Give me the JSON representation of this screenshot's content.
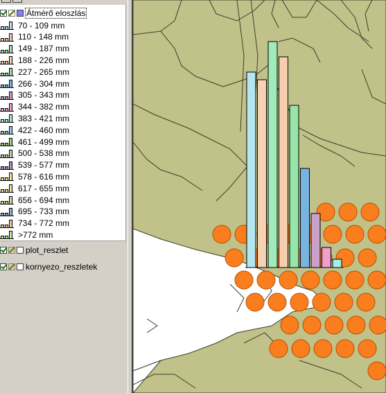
{
  "legend": {
    "layer_title": "Átmérő eloszlás",
    "classes": [
      {
        "label": "70 - 109 mm",
        "color": "#b4e6f0"
      },
      {
        "label": "110 - 148 mm",
        "color": "#f5d2b4"
      },
      {
        "label": "149 - 187 mm",
        "color": "#a0ebb9"
      },
      {
        "label": "188 - 226 mm",
        "color": "#f5cdaf"
      },
      {
        "label": "227 - 265 mm",
        "color": "#96e6aa"
      },
      {
        "label": "266 - 304 mm",
        "color": "#78b4e1"
      },
      {
        "label": "305 - 343 mm",
        "color": "#c8a0c8"
      },
      {
        "label": "344 - 382 mm",
        "color": "#f0a0c8"
      },
      {
        "label": "383 - 421 mm",
        "color": "#a0f0e6"
      },
      {
        "label": "422 - 460 mm",
        "color": "#a0c8f0"
      },
      {
        "label": "461 - 499 mm",
        "color": "#a0d278"
      },
      {
        "label": "500 - 538 mm",
        "color": "#c8d2aa"
      },
      {
        "label": "539 - 577 mm",
        "color": "#b48cd2"
      },
      {
        "label": "578 - 616 mm",
        "color": "#f0e68c"
      },
      {
        "label": "617 - 655 mm",
        "color": "#f0dca0"
      },
      {
        "label": "656 - 694 mm",
        "color": "#d2dc8c"
      },
      {
        "label": "695 - 733 mm",
        "color": "#8cb4dc"
      },
      {
        "label": "734 - 772 mm",
        "color": "#f0c8a0"
      },
      {
        "label": ">772 mm",
        "color": "#c8e6a0"
      }
    ],
    "other_layers": [
      {
        "label": "plot_reszlet"
      },
      {
        "label": "kornyezo_reszletek"
      }
    ]
  },
  "map": {
    "colors": {
      "land": "#c1c18a",
      "void": "#ffffff",
      "outline": "#3c3c28",
      "dot": "#fa7d1e",
      "dot_edge": "#b45000"
    },
    "histogram": {
      "categories": [
        "70 - 109 mm",
        "110 - 148 mm",
        "149 - 187 mm",
        "188 - 226 mm",
        "227 - 265 mm",
        "266 - 304 mm",
        "305 - 343 mm",
        "344 - 382 mm",
        "383 - 421 mm"
      ],
      "values": [
        282,
        271,
        326,
        304,
        234,
        143,
        78,
        29,
        12
      ]
    }
  }
}
